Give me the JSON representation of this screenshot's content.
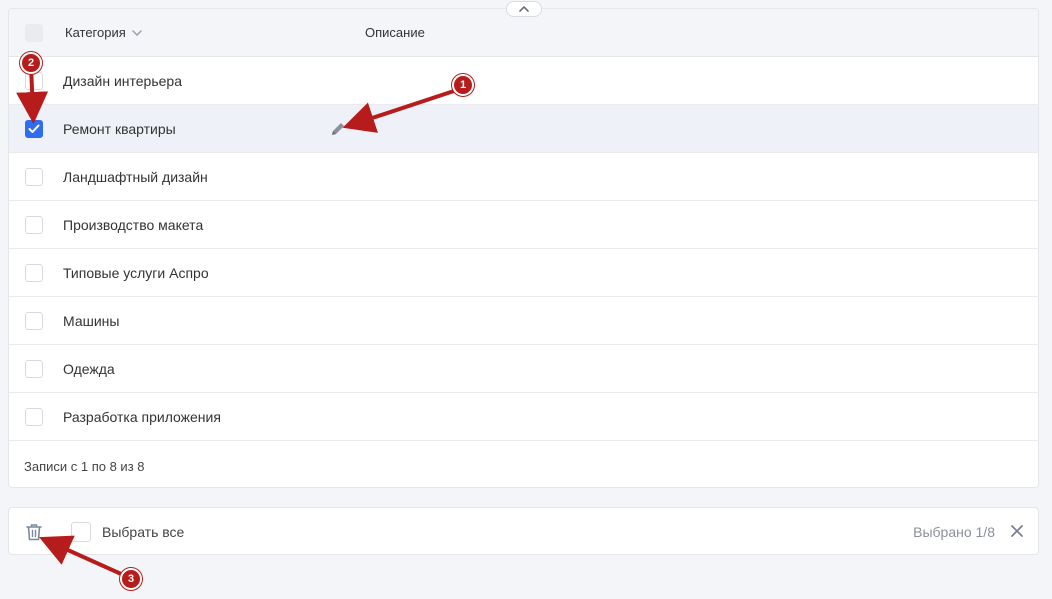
{
  "table": {
    "columns": {
      "category": "Категория",
      "description": "Описание"
    },
    "rows": [
      {
        "label": "Дизайн интерьера",
        "checked": false
      },
      {
        "label": "Ремонт квартиры",
        "checked": true
      },
      {
        "label": "Ландшафтный дизайн",
        "checked": false
      },
      {
        "label": "Производство макета",
        "checked": false
      },
      {
        "label": "Типовые услуги Аспро",
        "checked": false
      },
      {
        "label": "Машины",
        "checked": false
      },
      {
        "label": "Одежда",
        "checked": false
      },
      {
        "label": "Разработка приложения",
        "checked": false
      }
    ],
    "footer": "Записи с 1 по 8 из 8"
  },
  "bottom_bar": {
    "select_all_label": "Выбрать все",
    "selected_count": "Выбрано 1/8"
  },
  "annotations": {
    "badge1": "1",
    "badge2": "2",
    "badge3": "3"
  },
  "colors": {
    "accent": "#2f6cf0",
    "annotation": "#b71c1c"
  }
}
